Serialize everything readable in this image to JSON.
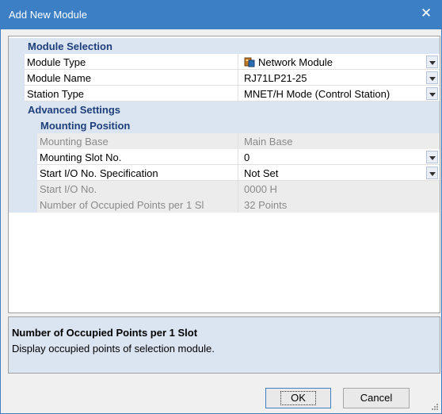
{
  "window": {
    "title": "Add New Module"
  },
  "sections": {
    "module_selection": "Module Selection",
    "advanced_settings": "Advanced Settings",
    "mounting_position": "Mounting Position"
  },
  "rows": {
    "module_type": {
      "name": "Module Type",
      "value": "Network Module",
      "icon": "network-module-icon"
    },
    "module_name": {
      "name": "Module Name",
      "value": "RJ71LP21-25"
    },
    "station_type": {
      "name": "Station Type",
      "value": "MNET/H Mode (Control Station)"
    },
    "mounting_base": {
      "name": "Mounting Base",
      "value": "Main Base"
    },
    "mounting_slot": {
      "name": "Mounting Slot No.",
      "value": "0"
    },
    "start_io_spec": {
      "name": "Start I/O No. Specification",
      "value": "Not Set"
    },
    "start_io": {
      "name": "Start I/O No.",
      "value": "0000 H"
    },
    "occupied_points": {
      "name": "Number of Occupied Points per 1 Sl",
      "value": "32 Points"
    }
  },
  "description": {
    "title": "Number of Occupied Points per 1 Slot",
    "text": "Display occupied points of selection module."
  },
  "buttons": {
    "ok": "OK",
    "cancel": "Cancel"
  },
  "colors": {
    "titlebar": "#3c7fc4",
    "category": "#dbe4f1",
    "category_text": "#1e3f7a"
  }
}
